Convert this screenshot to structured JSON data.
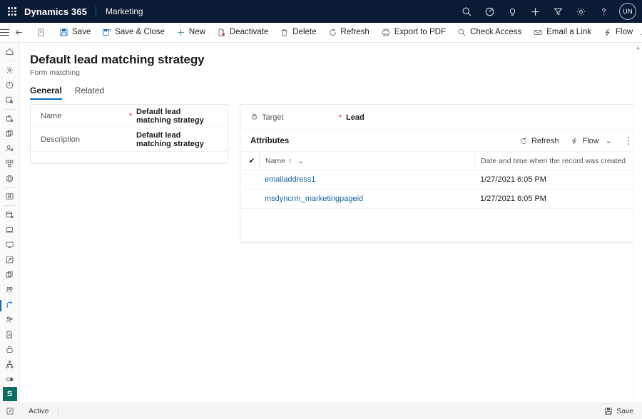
{
  "topbar": {
    "waffle_name": "app-launcher",
    "brand": "Dynamics 365",
    "app_name": "Marketing",
    "avatar_initials": "UN",
    "bg_color": "#0b1b36",
    "icons": [
      {
        "name": "search-icon",
        "label": "Search"
      },
      {
        "name": "focus-assist-icon",
        "label": "Focused view"
      },
      {
        "name": "lightbulb-icon",
        "label": "Insights"
      },
      {
        "name": "plus-icon",
        "label": "Quick create"
      },
      {
        "name": "filter-icon",
        "label": "Filter"
      },
      {
        "name": "gear-icon",
        "label": "Settings"
      },
      {
        "name": "help-icon",
        "label": "Help"
      }
    ]
  },
  "commandbar": {
    "hamburger_label": "Site map",
    "back_label": "Back",
    "form_icon_label": "Form",
    "items": [
      {
        "name": "save-button",
        "label": "Save",
        "icon": "save-icon"
      },
      {
        "name": "save-and-close-button",
        "label": "Save & Close",
        "icon": "save-close-icon"
      },
      {
        "name": "new-button",
        "label": "New",
        "icon": "plus-icon"
      },
      {
        "name": "deactivate-button",
        "label": "Deactivate",
        "icon": "deactivate-icon"
      },
      {
        "name": "delete-button",
        "label": "Delete",
        "icon": "trash-icon"
      },
      {
        "name": "refresh-button",
        "label": "Refresh",
        "icon": "refresh-icon"
      },
      {
        "name": "export-to-pdf-button",
        "label": "Export to PDF",
        "icon": "pdf-icon"
      },
      {
        "name": "check-access-button",
        "label": "Check Access",
        "icon": "key-icon"
      },
      {
        "name": "email-a-link-button",
        "label": "Email a Link",
        "icon": "email-icon"
      },
      {
        "name": "flow-button",
        "label": "Flow",
        "icon": "flow-icon",
        "chevron": "⌄"
      }
    ],
    "overflow": "⋮"
  },
  "rail": {
    "items": [
      {
        "name": "rail-item-home",
        "icon": "home-icon"
      },
      {
        "name": "rail-item-settings",
        "icon": "gear-icon"
      },
      {
        "name": "rail-item-recent",
        "icon": "clock-icon"
      },
      {
        "name": "rail-item-pinned",
        "icon": "pin-board-icon"
      },
      {
        "name": "rail-item-accounts",
        "icon": "briefcase-icon"
      },
      {
        "name": "rail-item-copy",
        "icon": "copy-icon"
      },
      {
        "name": "rail-item-contacts",
        "icon": "person-icon"
      },
      {
        "name": "rail-item-segments",
        "icon": "segment-icon"
      },
      {
        "name": "rail-item-security",
        "icon": "shield-icon"
      },
      {
        "name": "rail-item-id-card",
        "icon": "id-card-icon"
      },
      {
        "name": "rail-item-form-settings",
        "icon": "window-gear-icon"
      },
      {
        "name": "rail-item-laptop",
        "icon": "laptop-icon"
      },
      {
        "name": "rail-item-monitor",
        "icon": "monitor-icon"
      },
      {
        "name": "rail-item-edit",
        "icon": "edit-square-icon"
      },
      {
        "name": "rail-item-pages",
        "icon": "pages-icon"
      },
      {
        "name": "rail-item-customers",
        "icon": "customers-icon"
      },
      {
        "name": "rail-item-journeys",
        "icon": "journey-icon",
        "selected": true
      },
      {
        "name": "rail-item-leads",
        "icon": "people-icon"
      },
      {
        "name": "rail-item-reports",
        "icon": "report-icon"
      },
      {
        "name": "rail-item-locked",
        "icon": "lock-icon"
      },
      {
        "name": "rail-item-hierarchy",
        "icon": "hierarchy-icon"
      },
      {
        "name": "rail-item-toggle",
        "icon": "toggle-icon"
      }
    ],
    "badge": "S",
    "badge_color": "#0f6e63",
    "selected_accent": "#0f6cbd"
  },
  "page": {
    "title": "Default lead matching strategy",
    "subtitle": "Form matching",
    "tabs": [
      {
        "name": "tab-general",
        "label": "General",
        "active": true
      },
      {
        "name": "tab-related",
        "label": "Related",
        "active": false
      }
    ]
  },
  "left_card": {
    "fields": [
      {
        "name": "name-field",
        "label": "Name",
        "required": "*",
        "value": "Default lead matching strategy"
      },
      {
        "name": "description-field",
        "label": "Description",
        "required": "",
        "value": "Default lead matching strategy"
      }
    ]
  },
  "right_card": {
    "target": {
      "label": "Target",
      "lock_icon": "lock-icon",
      "required": "*",
      "value": "Lead"
    },
    "subgrid": {
      "title": "Attributes",
      "actions": [
        {
          "name": "subgrid-refresh-button",
          "label": "Refresh",
          "icon": "refresh-icon"
        },
        {
          "name": "subgrid-flow-button",
          "label": "Flow",
          "icon": "flow-icon",
          "chevron": "⌄"
        }
      ],
      "overflow": "⋮",
      "select_all": "✔",
      "columns": [
        {
          "name": "column-name",
          "label": "Name",
          "sort": "↑",
          "chevron": "⌄"
        },
        {
          "name": "column-created-on",
          "label": "Date and time when the record was created",
          "sort": "",
          "chevron": "⌄"
        }
      ],
      "rows": [
        {
          "name": "emailaddress1",
          "created_on": "1/27/2021 6:05 PM"
        },
        {
          "name": "msdyncrm_marketingpageid",
          "created_on": "1/27/2021 6:05 PM"
        }
      ]
    }
  },
  "statusbar": {
    "expand_icon": "expand-icon",
    "status": "Active",
    "save_label": "Save",
    "save_icon": "save-icon"
  }
}
